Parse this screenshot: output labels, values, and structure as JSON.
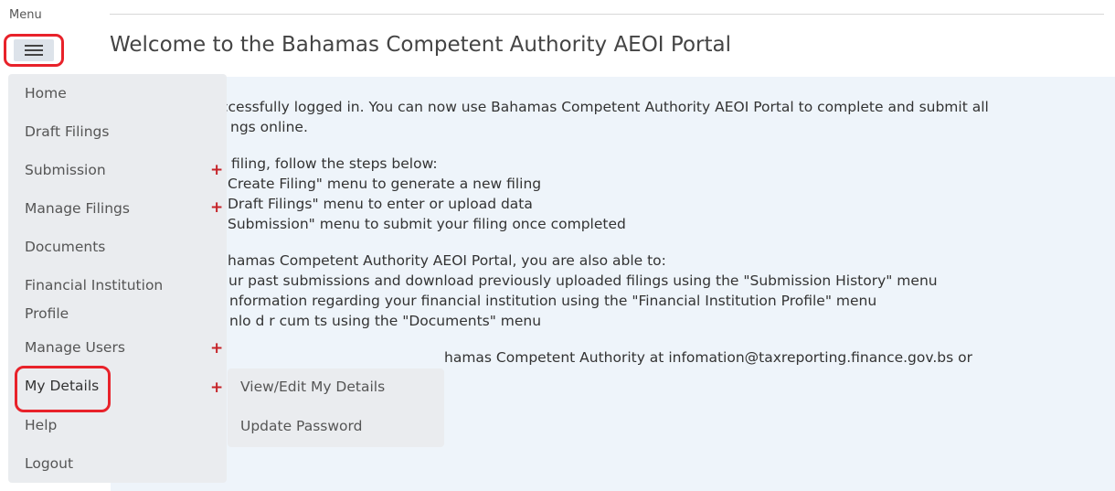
{
  "menu": {
    "label": "Menu",
    "items": [
      {
        "label": "Home"
      },
      {
        "label": "Draft Filings"
      },
      {
        "label": "Submission"
      },
      {
        "label": "Manage Filings"
      },
      {
        "label": "Documents"
      },
      {
        "label": "Financial Institution"
      },
      {
        "label": "Profile"
      },
      {
        "label": "Manage Users"
      },
      {
        "label": "My Details"
      },
      {
        "label": "Help"
      },
      {
        "label": "Logout"
      }
    ],
    "expander_symbol": "+"
  },
  "submenu": {
    "items": [
      {
        "label": "View/Edit My Details"
      },
      {
        "label": "Update Password"
      }
    ]
  },
  "page": {
    "title": "Welcome to the Bahamas Competent Authority AEOI Portal"
  },
  "content": {
    "lines": [
      "ccessfully logged in. You can now use Bahamas Competent Authority AEOI Portal to complete and submit all",
      "ngs online.",
      "filing, follow the steps below:",
      "Create Filing\" menu to generate a new filing",
      "Draft Filings\" menu to enter or upload data",
      "Submission\" menu to submit your filing once completed",
      "hamas Competent Authority AEOI Portal, you are also able to:",
      "ur past submissions and download previously uploaded filings using the \"Submission History\" menu",
      "nformation regarding your financial institution using the \"Financial Institution Profile\" menu",
      "nlo   d r         cum   ts using the \"Documents\" menu",
      "hamas Competent Authority at infomation@taxreporting.finance.gov.bs or"
    ]
  },
  "colors": {
    "accent_red": "#c62328",
    "highlight_red": "#e8222a",
    "content_bg": "#eef4fa",
    "menu_bg": "#eaecef"
  }
}
